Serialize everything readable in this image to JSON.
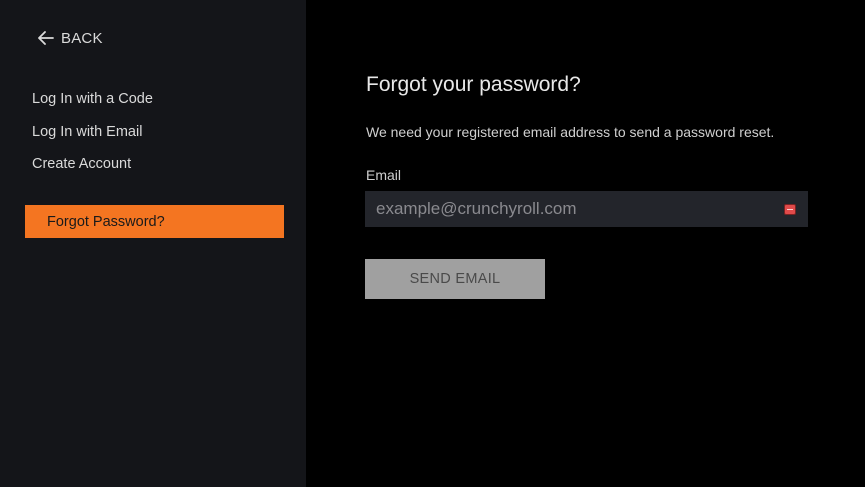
{
  "sidebar": {
    "back_label": "BACK",
    "items": [
      {
        "label": "Log In with a Code"
      },
      {
        "label": "Log In with Email"
      },
      {
        "label": "Create Account"
      }
    ],
    "active_item": {
      "label": "Forgot Password?"
    }
  },
  "main": {
    "title": "Forgot your password?",
    "subtitle": "We need your registered email address to send a password reset.",
    "email_label": "Email",
    "email_placeholder": "example@crunchyroll.com",
    "email_value": "",
    "send_button_label": "SEND EMAIL"
  },
  "icons": {
    "back": "arrow-left-icon",
    "autofill": "password-manager-icon"
  },
  "colors": {
    "accent": "#f47521",
    "sidebar_bg": "#141519",
    "main_bg": "#000000",
    "input_bg": "#23252b",
    "button_disabled_bg": "#a0a0a0"
  }
}
